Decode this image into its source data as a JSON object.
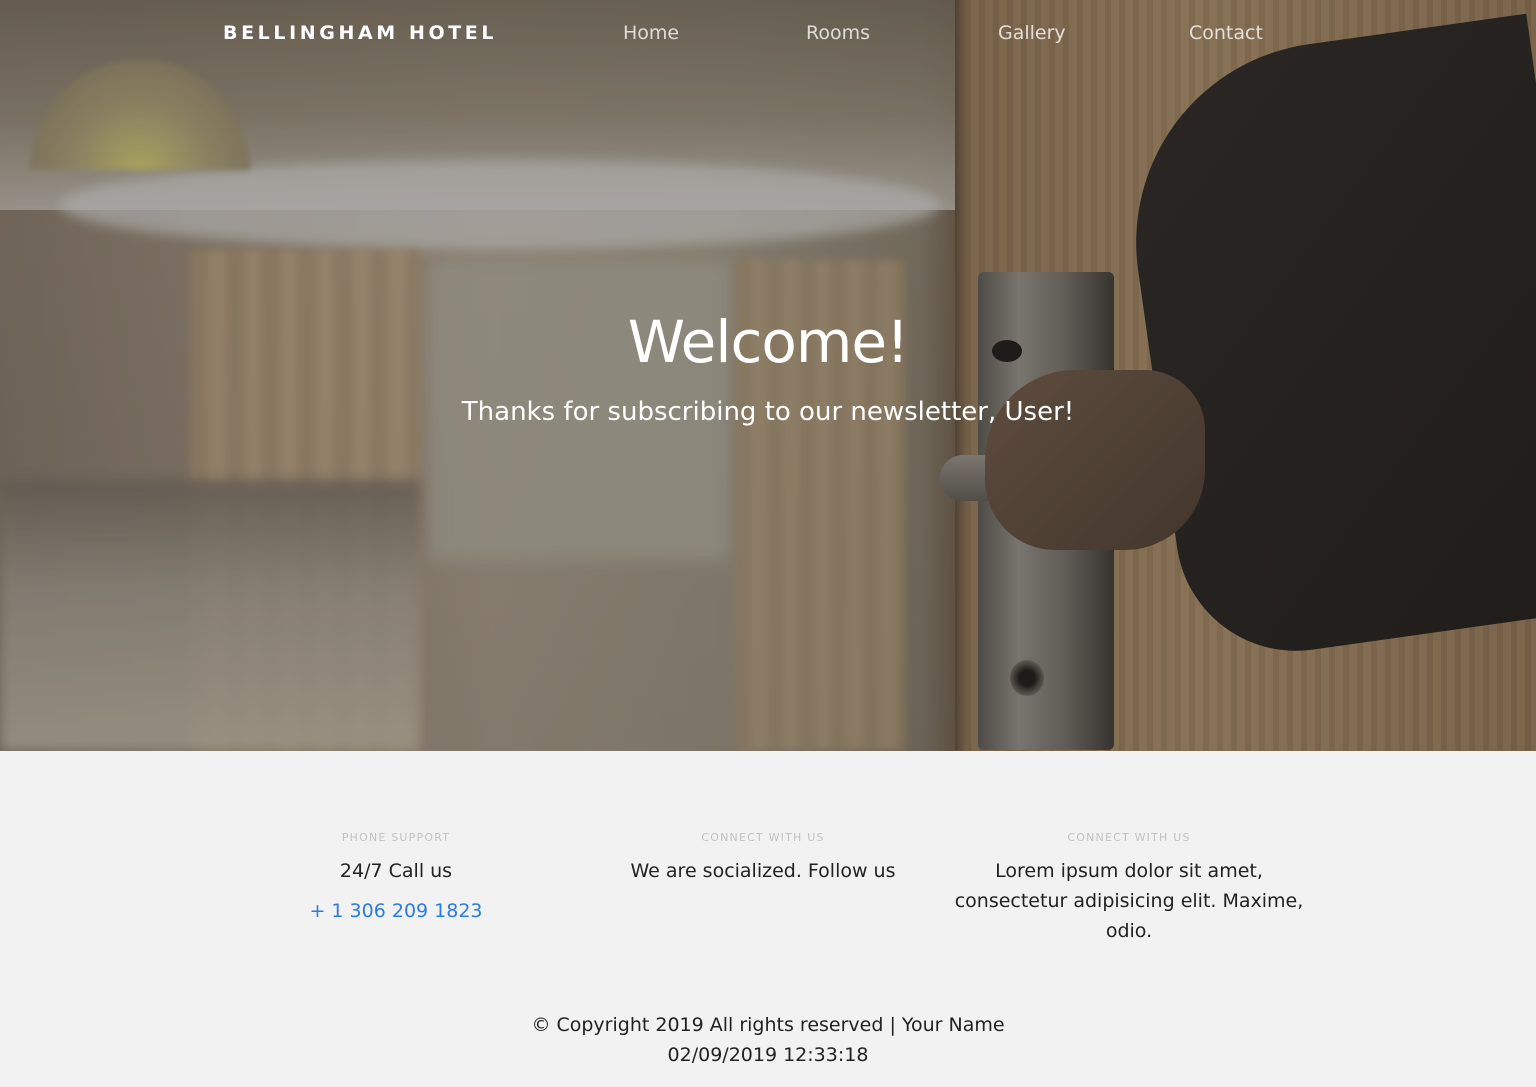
{
  "nav": {
    "brand": "BELLINGHAM HOTEL",
    "links": [
      {
        "label": "Home"
      },
      {
        "label": "Rooms"
      },
      {
        "label": "Gallery"
      },
      {
        "label": "Contact"
      }
    ]
  },
  "hero": {
    "title": "Welcome!",
    "subtitle": "Thanks for subscribing to our newsletter, User!"
  },
  "footer": {
    "columns": [
      {
        "label": "PHONE SUPPORT",
        "text": "24/7 Call us",
        "link": "+ 1 306 209 1823"
      },
      {
        "label": "CONNECT WITH US",
        "text": "We are socialized. Follow us"
      },
      {
        "label": "CONNECT WITH US",
        "text": "Lorem ipsum dolor sit amet, consectetur adipisicing elit. Maxime, odio."
      }
    ],
    "copyright": "© Copyright 2019 All rights reserved | Your Name",
    "timestamp": "02/09/2019 12:33:18"
  },
  "colors": {
    "link": "#2b7be0",
    "footer_bg": "#f2f2f2",
    "label": "#c2c2c2"
  }
}
